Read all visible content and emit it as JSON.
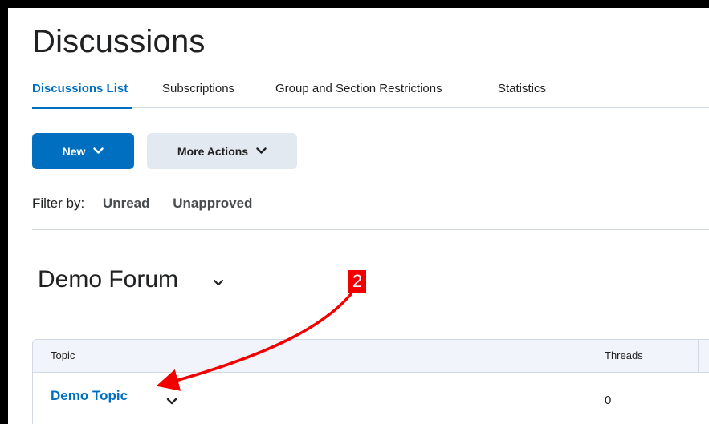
{
  "page": {
    "title": "Discussions"
  },
  "tabs": [
    {
      "label": "Discussions List",
      "active": true
    },
    {
      "label": "Subscriptions",
      "active": false
    },
    {
      "label": "Group and Section Restrictions",
      "active": false
    },
    {
      "label": "Statistics",
      "active": false
    }
  ],
  "toolbar": {
    "new_label": "New",
    "more_actions_label": "More Actions"
  },
  "filter": {
    "label": "Filter by:",
    "options": [
      "Unread",
      "Unapproved"
    ]
  },
  "forum": {
    "title": "Demo Forum"
  },
  "table": {
    "columns": [
      "Topic",
      "Threads"
    ],
    "rows": [
      {
        "topic": "Demo Topic",
        "threads": "0"
      }
    ]
  },
  "annotation": {
    "step_number": "2",
    "color": "#f20000"
  },
  "colors": {
    "accent": "#006fbf",
    "secondary_button": "#e3e9f1",
    "text": "#202122"
  }
}
